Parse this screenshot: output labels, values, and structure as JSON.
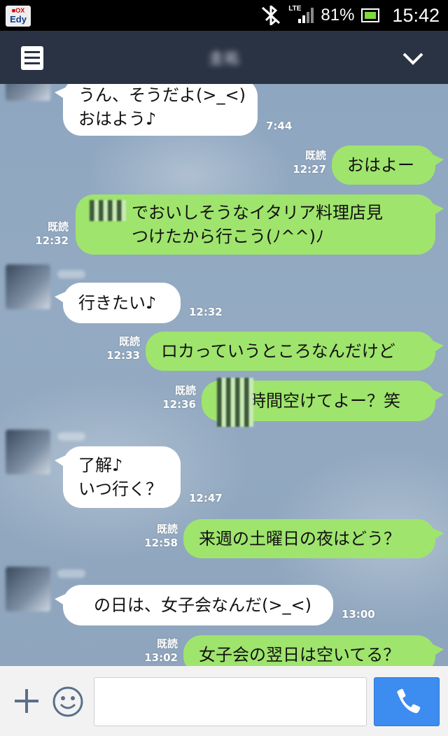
{
  "status_bar": {
    "edy_top": "■OX",
    "edy_bottom": "Edy",
    "network": "LTE",
    "battery": "81%",
    "time": "15:42"
  },
  "header": {
    "title": "圭祐"
  },
  "messages": [
    {
      "dir": "in",
      "lines": [
        "うん、そうだよ(>_<)",
        "おはよう♪"
      ],
      "time": "7:44"
    },
    {
      "dir": "out",
      "lines": [
        "おはよー"
      ],
      "read": "既読",
      "time": "12:27"
    },
    {
      "dir": "out",
      "lines": [
        "でおいしそうなイタリア料理店見",
        "つけたから行こう(ﾉ^^)ﾉ"
      ],
      "read": "既読",
      "time": "12:32"
    },
    {
      "dir": "in",
      "lines": [
        "行きたい♪"
      ],
      "time": "12:32"
    },
    {
      "dir": "out",
      "lines": [
        "ロカっていうところなんだけど"
      ],
      "read": "既読",
      "time": "12:33"
    },
    {
      "dir": "out",
      "lines": [
        "時間空けてよー？笑"
      ],
      "read": "既読",
      "time": "12:36"
    },
    {
      "dir": "in",
      "lines": [
        "了解♪",
        "いつ行く？"
      ],
      "time": "12:47"
    },
    {
      "dir": "out",
      "lines": [
        "来週の土曜日の夜はどう？"
      ],
      "read": "既読",
      "time": "12:58"
    },
    {
      "dir": "in",
      "lines": [
        "の日は、女子会なんだ(>_<)"
      ],
      "time": "13:00"
    },
    {
      "dir": "out",
      "lines": [
        "女子会の翌日は空いてる？"
      ],
      "read": "既読",
      "time": "13:02"
    }
  ],
  "icons": {
    "menu": "menu-icon",
    "collapse": "chevron-down-icon",
    "add": "plus-icon",
    "emoji": "smiley-icon",
    "call": "phone-icon"
  },
  "colors": {
    "header_bg": "#2a3344",
    "outgoing_bubble": "#9fe46d",
    "incoming_bubble": "#ffffff",
    "call_button": "#3d8cf0"
  }
}
